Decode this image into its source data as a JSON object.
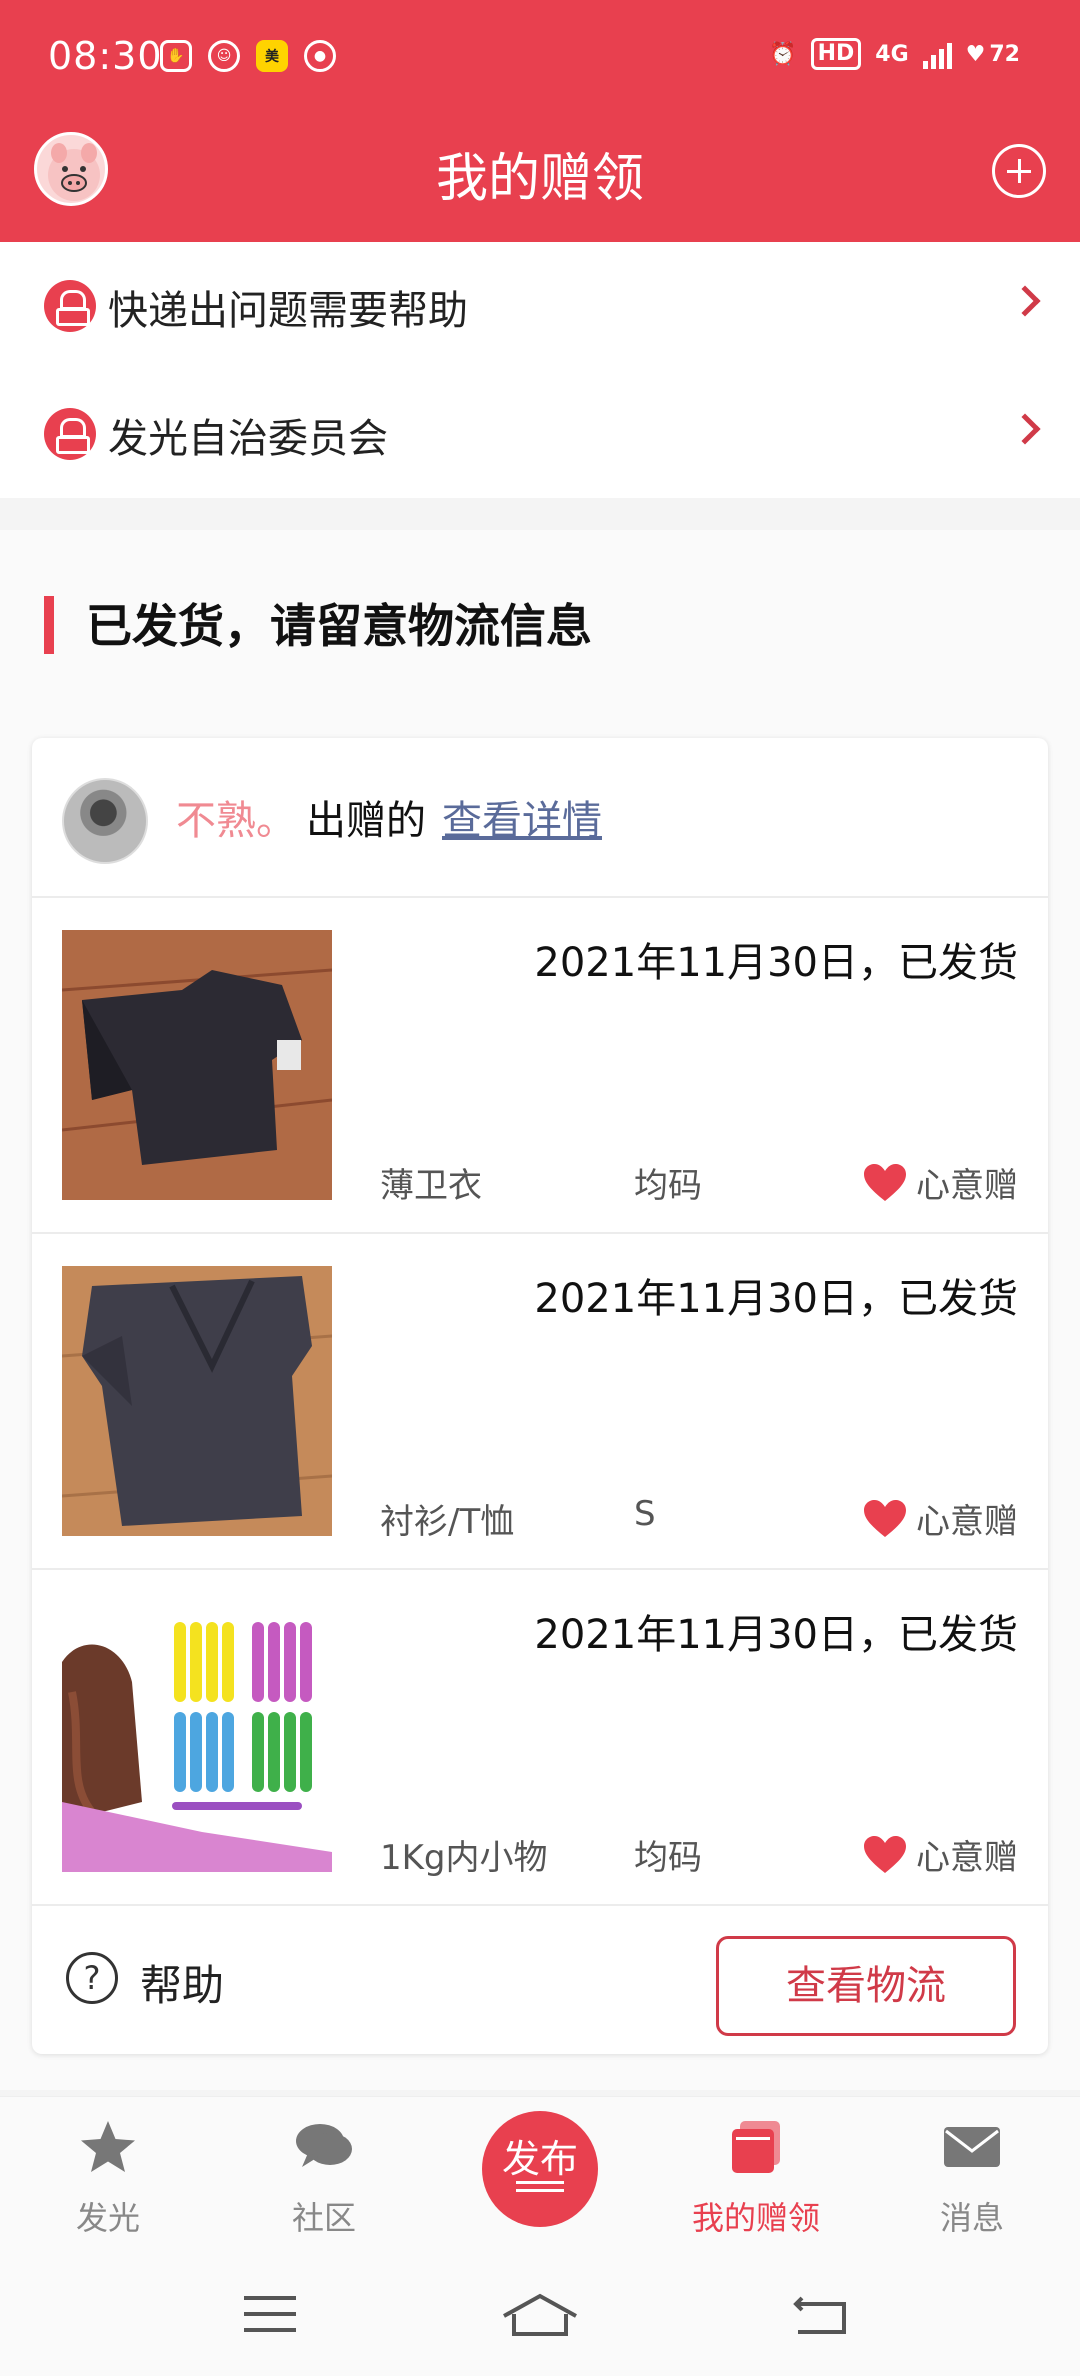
{
  "status_bar": {
    "time": "08:30",
    "left_icons": [
      "app-icon",
      "app-icon",
      "meituan-icon",
      "wechat-icon"
    ],
    "right_text": {
      "hd": "HD",
      "network": "4G",
      "battery": "72"
    }
  },
  "header": {
    "title": "我的赠领"
  },
  "help_links": [
    {
      "label": "快递出问题需要帮助"
    },
    {
      "label": "发光自治委员会"
    }
  ],
  "section": {
    "title": "已发货，请留意物流信息"
  },
  "card": {
    "donor_name": "不熟。",
    "donor_suffix": "出赠的",
    "detail_link": "查看详情",
    "items": [
      {
        "date_status": "2021年11月30日，已发货",
        "name": "薄卫衣",
        "size": "均码",
        "tag": "心意赠"
      },
      {
        "date_status": "2021年11月30日，已发货",
        "name": "衬衫/T恤",
        "size": "S",
        "tag": "心意赠"
      },
      {
        "date_status": "2021年11月30日，已发货",
        "name": "1Kg内小物",
        "size": "均码",
        "tag": "心意赠"
      }
    ],
    "help_label": "帮助",
    "track_button": "查看物流"
  },
  "bottom_nav": {
    "items": [
      {
        "label": "发光"
      },
      {
        "label": "社区"
      },
      {
        "label": "发布"
      },
      {
        "label": "我的赠领"
      },
      {
        "label": "消息"
      }
    ],
    "active": "我的赠领"
  },
  "colors": {
    "brand": "#e8404f",
    "link": "#5a6b9a",
    "donor_name": "#f08a92"
  }
}
